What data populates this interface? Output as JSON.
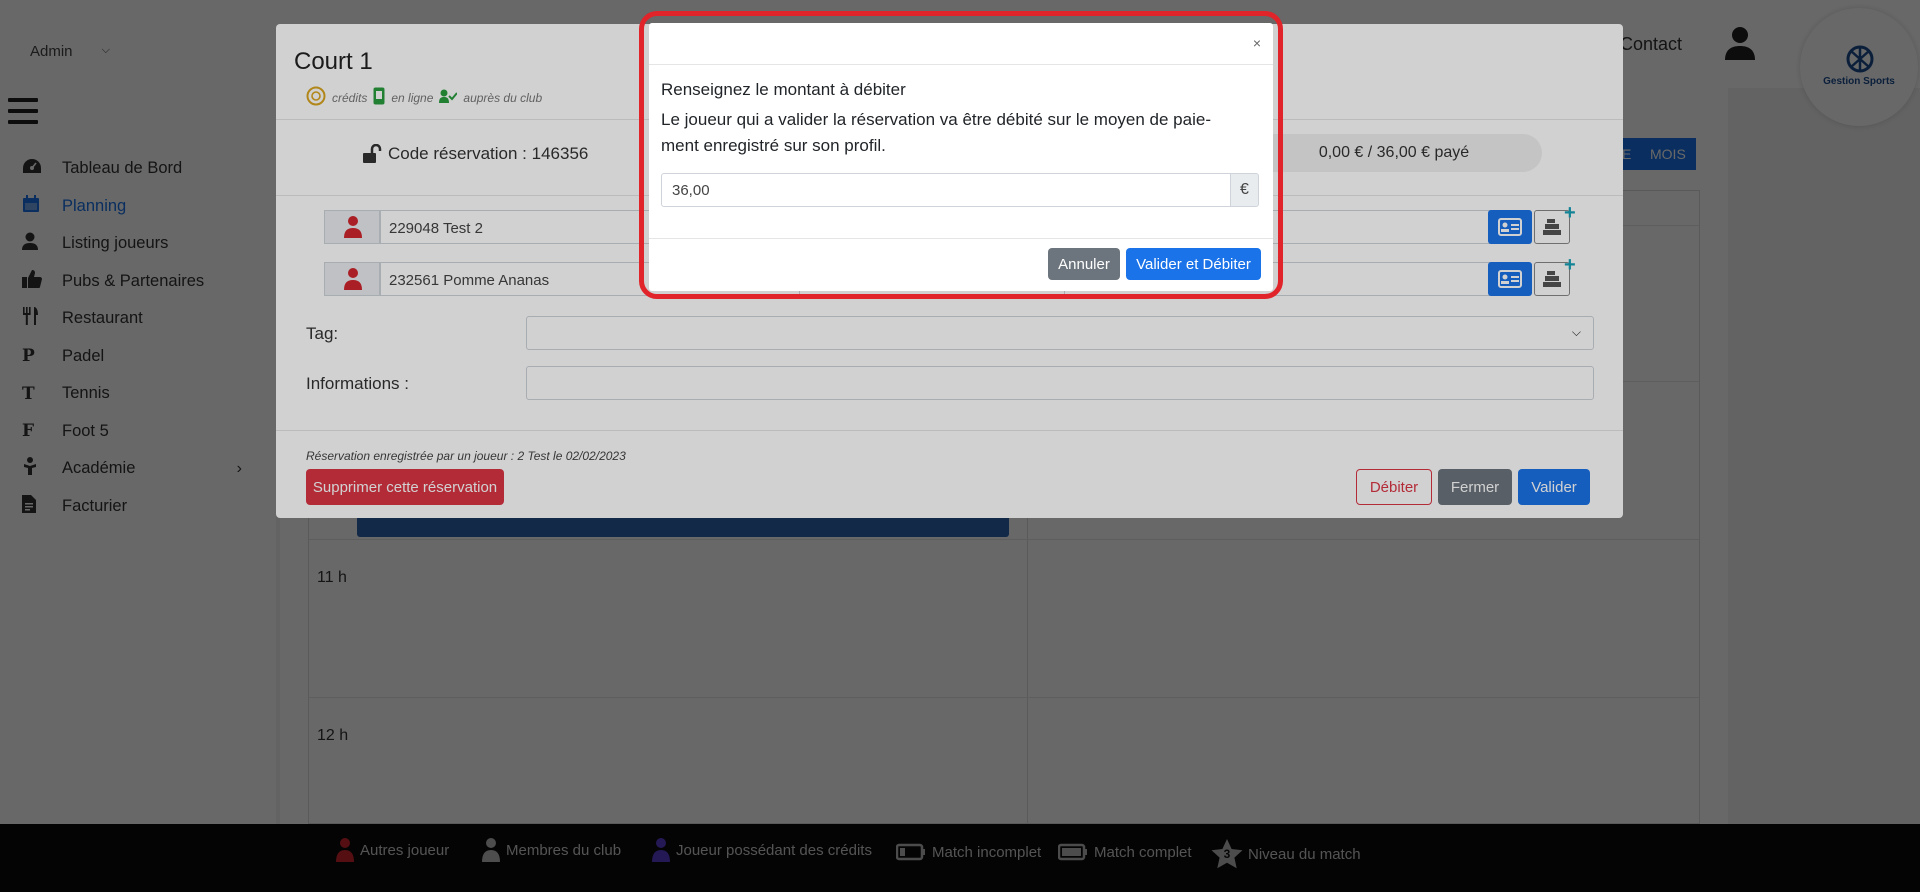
{
  "sidebar": {
    "admin_select": "Admin",
    "nav": [
      {
        "label": "Tableau de Bord",
        "icon": "dashboard-icon"
      },
      {
        "label": "Planning",
        "icon": "calendar-icon",
        "active": true
      },
      {
        "label": "Listing joueurs",
        "icon": "user-icon"
      },
      {
        "label": "Pubs & Partenaires",
        "icon": "thumbs-up-icon"
      },
      {
        "label": "Restaurant",
        "icon": "utensils-icon"
      },
      {
        "label": "Padel",
        "icon": "letter-p-icon",
        "glyph": "P"
      },
      {
        "label": "Tennis",
        "icon": "letter-t-icon",
        "glyph": "T"
      },
      {
        "label": "Foot 5",
        "icon": "letter-f-icon",
        "glyph": "F"
      },
      {
        "label": "Académie",
        "icon": "academy-icon"
      },
      {
        "label": "Facturier",
        "icon": "invoice-icon"
      }
    ]
  },
  "topbar": {
    "contact": "Contact",
    "logo_text": "Gestion Sports"
  },
  "calendar": {
    "view_buttons": [
      "E",
      "MOIS"
    ],
    "hours": [
      "11 h",
      "12 h"
    ]
  },
  "court_modal": {
    "title": "Court 1",
    "payment_methods": [
      "crédits",
      "en ligne",
      "auprès du club"
    ],
    "code_label": "Code réservation : 146356",
    "paid_label": "0,00 € / 36,00 € payé",
    "players": [
      {
        "name": "229048 Test 2"
      },
      {
        "name": "232561 Pomme Ananas"
      }
    ],
    "tag_label": "Tag:",
    "info_label": "Informations :",
    "note": "Réservation enregistrée par un joueur : 2 Test le 02/02/2023",
    "buttons": {
      "delete": "Supprimer cette réservation",
      "debit": "Débiter",
      "close": "Fermer",
      "validate": "Valider"
    }
  },
  "debit_modal": {
    "close_glyph": "×",
    "title": "Renseignez le montant à débiter",
    "text": "Le joueur qui a valider la réservation va être débité sur le moyen de paie-ment enregistré sur son profil.",
    "amount_value": "36,00",
    "currency": "€",
    "buttons": {
      "cancel": "Annuler",
      "confirm": "Valider et Débiter"
    }
  },
  "legend": [
    {
      "label": "Autres joueur",
      "color": "#d0262e"
    },
    {
      "label": "Membres du club",
      "color": "#bdbdbd"
    },
    {
      "label": "Joueur possédant des crédits",
      "color": "#5a3fd0"
    },
    {
      "label": "Match incomplet"
    },
    {
      "label": "Match complet"
    },
    {
      "label": "Niveau du match",
      "badge": "3"
    }
  ]
}
